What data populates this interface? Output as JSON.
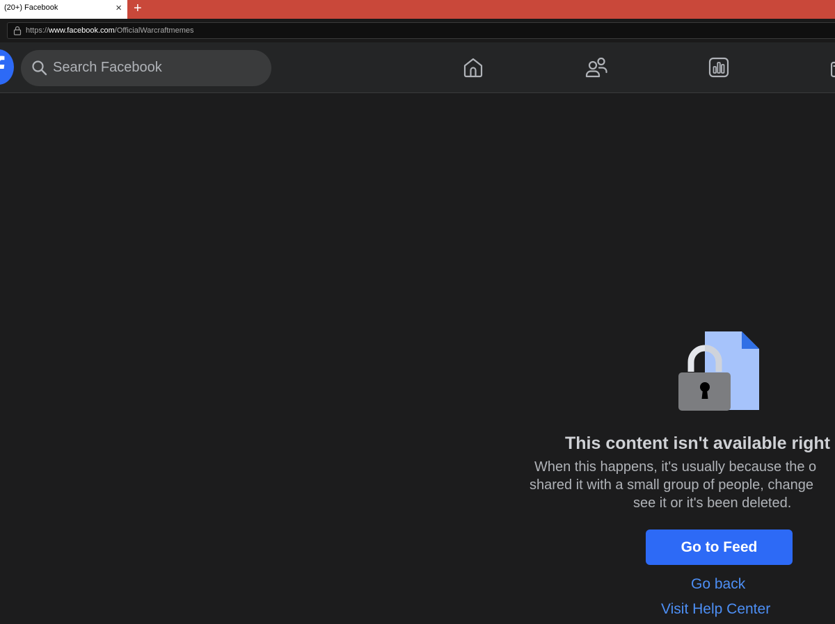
{
  "browser": {
    "tab_title": "(20+) Facebook",
    "tab_close": "×",
    "new_tab": "+",
    "url_scheme": "https://",
    "url_host": "www.facebook.com",
    "url_path": "/OfficialWarcraftmemes"
  },
  "header": {
    "search_placeholder": "Search Facebook",
    "nav_icons": [
      "home-icon",
      "friends-icon",
      "dashboard-icon",
      "marketplace-icon"
    ]
  },
  "main": {
    "title": "This content isn't available right",
    "desc_lines": [
      "When this happens, it's usually because the o",
      "shared it with a small group of people, change",
      "see it or it's been deleted."
    ],
    "feed_button": "Go to Feed",
    "go_back": "Go back",
    "help_center": "Visit Help Center"
  },
  "colors": {
    "tabbar": "#c9483a",
    "header_bg": "#242526",
    "page_bg": "#1c1c1d",
    "primary_button": "#2d6af6",
    "link": "#4d8ff5"
  }
}
